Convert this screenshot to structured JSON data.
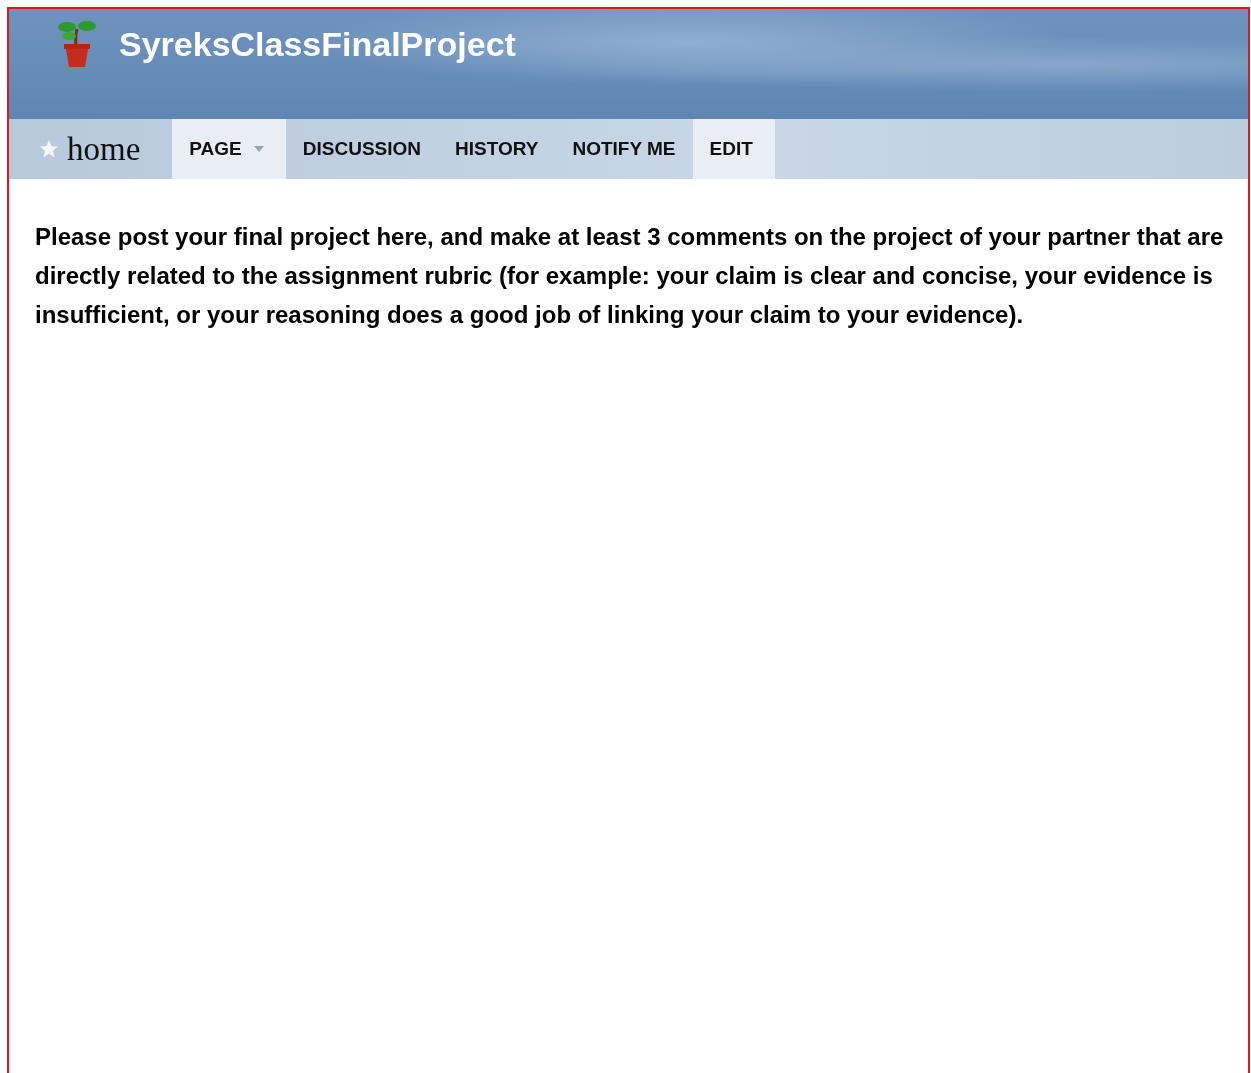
{
  "site": {
    "title": "SyreksClassFinalProject"
  },
  "nav": {
    "home": "home",
    "tabs": [
      {
        "label": "PAGE",
        "highlighted": true,
        "kind": "dropdown"
      },
      {
        "label": "DISCUSSION",
        "highlighted": false,
        "kind": "link"
      },
      {
        "label": "HISTORY",
        "highlighted": false,
        "kind": "link"
      },
      {
        "label": "NOTIFY ME",
        "highlighted": false,
        "kind": "link"
      },
      {
        "label": "EDIT",
        "highlighted": true,
        "kind": "link"
      }
    ]
  },
  "content": {
    "text": "Please post your final project here, and make at least 3 comments on the project of your partner that are directly related to the assignment rubric (for example: your claim is clear and concise, your evidence is insufficient, or your reasoning does a good job of linking your claim to your evidence)."
  }
}
